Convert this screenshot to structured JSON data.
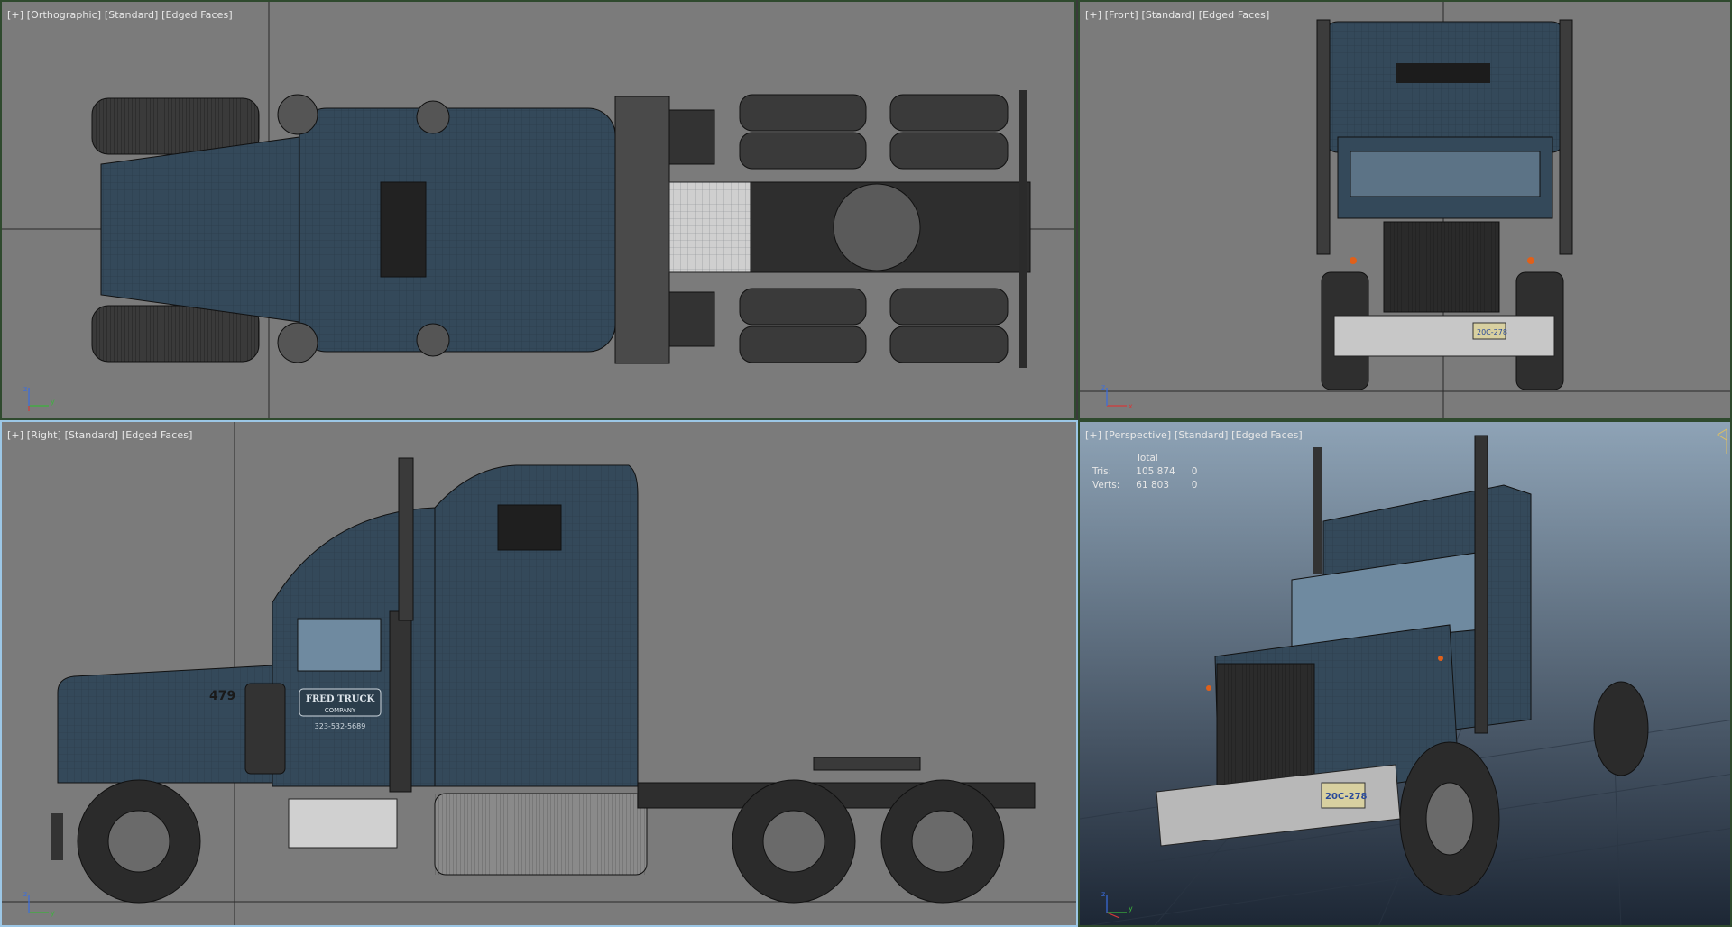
{
  "viewports": {
    "top": {
      "plus": "[+]",
      "view": "[Orthographic]",
      "shading": "[Standard]",
      "mode": "[Edged Faces]"
    },
    "front": {
      "plus": "[+]",
      "view": "[Front]",
      "shading": "[Standard]",
      "mode": "[Edged Faces]"
    },
    "right": {
      "plus": "[+]",
      "view": "[Right]",
      "shading": "[Standard]",
      "mode": "[Edged Faces]"
    },
    "perspective": {
      "plus": "[+]",
      "view": "[Perspective]",
      "shading": "[Standard]",
      "mode": "[Edged Faces]"
    }
  },
  "stats": {
    "header": "Total",
    "tris_label": "Tris:",
    "tris_value": "105 874",
    "tris_sel": "0",
    "verts_label": "Verts:",
    "verts_value": "61 803",
    "verts_sel": "0"
  },
  "truck": {
    "company": "FRED TRUCK",
    "company_sub": "COMPANY",
    "phone": "323-532-5689",
    "unit_number": "479",
    "plate": "20C-278"
  },
  "axis": {
    "x": "x",
    "y": "y",
    "z": "z"
  },
  "colors": {
    "viewport_bg": "#7b7b7b",
    "active_border": "#9cc7e6",
    "inactive_border": "#2f4a2e",
    "body_paint": "#34495a",
    "persp_bg_top": "#8ea3b6",
    "persp_bg_bottom": "#1d2735"
  }
}
